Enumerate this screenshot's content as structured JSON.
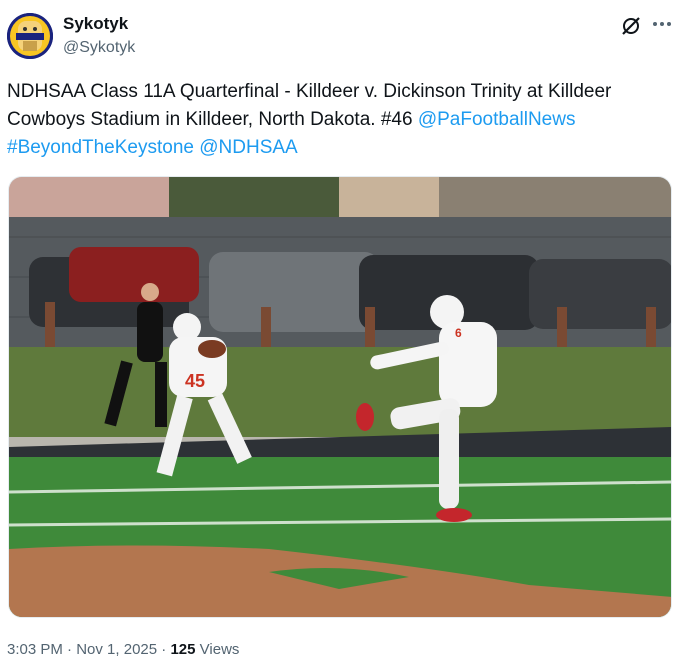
{
  "author": {
    "name": "Sykotyk",
    "handle": "@Sykotyk",
    "avatar_icon": "avatar-illustration-icon"
  },
  "post": {
    "text_main": "NDHSAA Class 11A Quarterfinal - Killdeer v. Dickinson Trinity at Killdeer Cowboys Stadium in Killdeer, North Dakota. #46 ",
    "mention_1": "@PaFootballNews",
    "hashtag": "#BeyondTheKeystone",
    "mention_2": "@NDHSAA"
  },
  "media": {
    "icon": "football-game-photo",
    "player_number_left": "45",
    "player_number_right": "6"
  },
  "meta": {
    "time": "3:03 PM",
    "separator": " · ",
    "date": "Nov 1, 2025",
    "views_count": "125",
    "views_label": "Views"
  },
  "icons": [
    "grok-icon",
    "more-icon"
  ],
  "colors": {
    "link": "#1d9bf0",
    "muted": "#536471",
    "text": "#0f1419"
  }
}
